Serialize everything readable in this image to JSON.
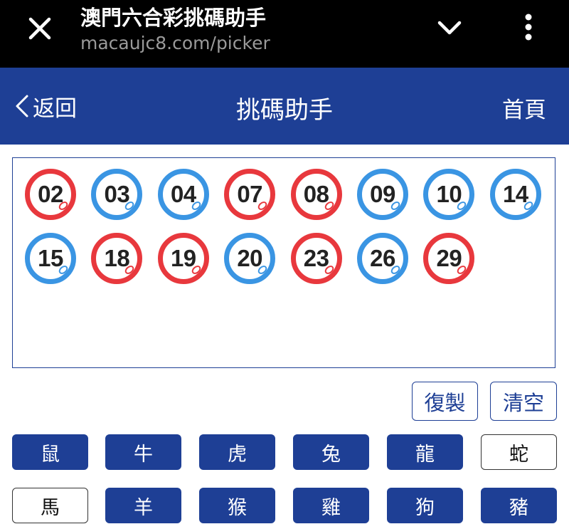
{
  "browser": {
    "page_title": "澳門六合彩挑碼助手",
    "url": "macaujc8.com/picker",
    "close_icon": "close-icon",
    "expand_icon": "chevron-down-icon",
    "menu_icon": "more-vertical-icon"
  },
  "header": {
    "back_label": "返回",
    "title": "挑碼助手",
    "home_label": "首頁",
    "background_color": "#1e3f95"
  },
  "picked_numbers": [
    {
      "number": "02",
      "color": "red"
    },
    {
      "number": "03",
      "color": "blue"
    },
    {
      "number": "04",
      "color": "blue"
    },
    {
      "number": "07",
      "color": "red"
    },
    {
      "number": "08",
      "color": "red"
    },
    {
      "number": "09",
      "color": "blue"
    },
    {
      "number": "10",
      "color": "blue"
    },
    {
      "number": "14",
      "color": "blue"
    },
    {
      "number": "15",
      "color": "blue"
    },
    {
      "number": "18",
      "color": "red"
    },
    {
      "number": "19",
      "color": "red"
    },
    {
      "number": "20",
      "color": "blue"
    },
    {
      "number": "23",
      "color": "red"
    },
    {
      "number": "26",
      "color": "blue"
    },
    {
      "number": "29",
      "color": "red"
    }
  ],
  "ball_colors": {
    "red": "#e8383d",
    "blue": "#3a95e3"
  },
  "actions": {
    "copy_label": "復製",
    "clear_label": "清空"
  },
  "zodiac": [
    {
      "label": "鼠",
      "selected": true
    },
    {
      "label": "牛",
      "selected": true
    },
    {
      "label": "虎",
      "selected": true
    },
    {
      "label": "兔",
      "selected": true
    },
    {
      "label": "龍",
      "selected": true
    },
    {
      "label": "蛇",
      "selected": false
    },
    {
      "label": "馬",
      "selected": false
    },
    {
      "label": "羊",
      "selected": true
    },
    {
      "label": "猴",
      "selected": true
    },
    {
      "label": "雞",
      "selected": true
    },
    {
      "label": "狗",
      "selected": true
    },
    {
      "label": "豬",
      "selected": true
    }
  ]
}
